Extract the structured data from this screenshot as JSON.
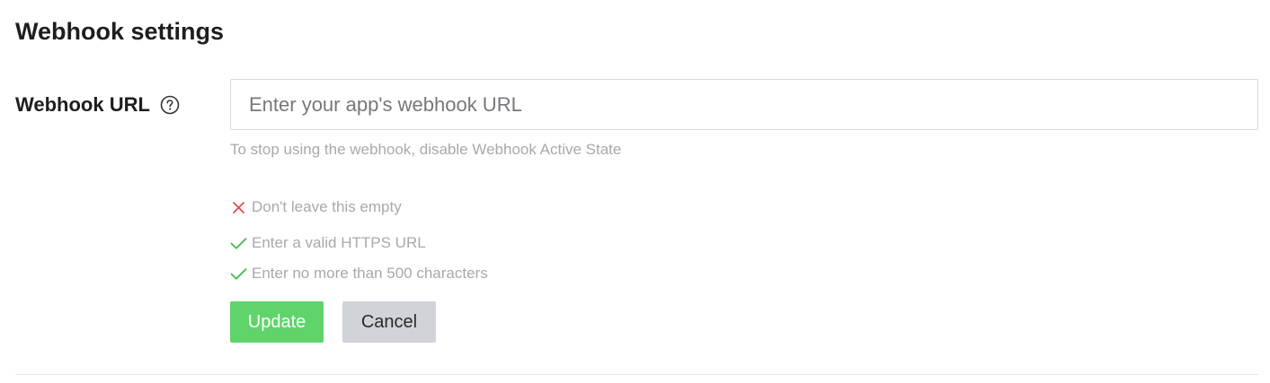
{
  "section": {
    "title": "Webhook settings"
  },
  "webhook_url": {
    "label": "Webhook URL",
    "help_icon": "question-circle-icon",
    "value": "",
    "placeholder": "Enter your app's webhook URL",
    "hint": "To stop using the webhook, disable Webhook Active State"
  },
  "validation": {
    "colors": {
      "failed": "#e0484e",
      "passed": "#3fbf4a"
    },
    "rules": [
      {
        "text": "Don't leave this empty",
        "status": "failed",
        "icon": "x-icon"
      },
      {
        "text": "Enter a valid HTTPS URL",
        "status": "passed",
        "icon": "check-icon"
      },
      {
        "text": "Enter no more than 500 characters",
        "status": "passed",
        "icon": "check-icon"
      }
    ]
  },
  "actions": {
    "update_label": "Update",
    "cancel_label": "Cancel",
    "update_color": "#5fd46a",
    "cancel_color": "#d0d3d8"
  }
}
